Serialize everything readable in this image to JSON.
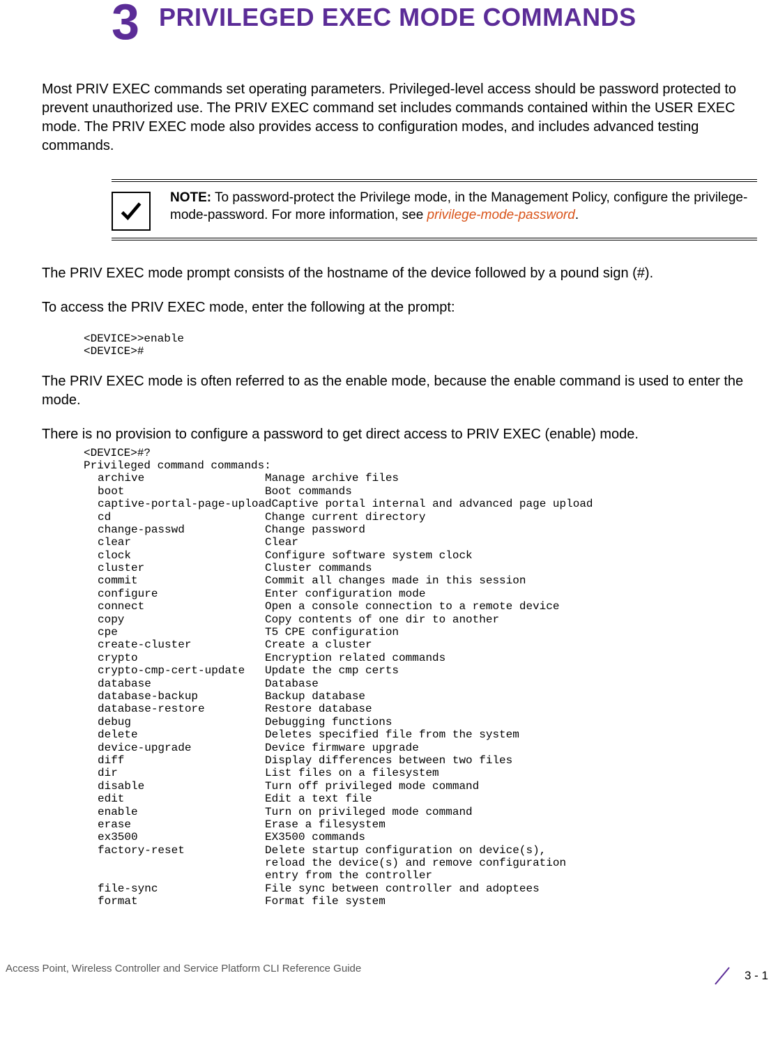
{
  "chapter": {
    "number": "3",
    "title": "PRIVILEGED EXEC MODE COMMANDS"
  },
  "intro": "Most PRIV EXEC commands set operating parameters. Privileged-level access should be password protected to prevent unauthorized use. The PRIV EXEC command set includes commands contained within the USER EXEC mode. The PRIV EXEC mode also provides access to configuration modes, and includes advanced testing commands.",
  "note": {
    "label": "NOTE:",
    "body": " To password-protect the Privilege mode, in the Management Policy, configure the privilege-mode-password. For more information, see ",
    "link": "privilege-mode-password"
  },
  "p1": "The PRIV EXEC mode prompt consists of the hostname of the device followed by a pound sign (#).",
  "p2": "To access the PRIV EXEC mode, enter the following at the prompt:",
  "cli1": "<DEVICE>>enable\n<DEVICE>#",
  "p3": "The PRIV EXEC mode is often referred to as the enable mode, because the enable command is used to enter the mode.",
  "p4": "There is no provision to configure a password to get direct access to PRIV EXEC (enable) mode.",
  "cli2_head1": "<DEVICE>#?",
  "cli2_head2": "Privileged command commands:",
  "commands": [
    {
      "name": "archive",
      "desc": "Manage archive files"
    },
    {
      "name": "boot",
      "desc": "Boot commands"
    },
    {
      "name": "captive-portal-page-upload",
      "desc": "Captive portal internal and advanced page upload"
    },
    {
      "name": "cd",
      "desc": "Change current directory"
    },
    {
      "name": "change-passwd",
      "desc": "Change password"
    },
    {
      "name": "clear",
      "desc": "Clear"
    },
    {
      "name": "clock",
      "desc": "Configure software system clock"
    },
    {
      "name": "cluster",
      "desc": "Cluster commands"
    },
    {
      "name": "commit",
      "desc": "Commit all changes made in this session"
    },
    {
      "name": "configure",
      "desc": "Enter configuration mode"
    },
    {
      "name": "connect",
      "desc": "Open a console connection to a remote device"
    },
    {
      "name": "copy",
      "desc": "Copy contents of one dir to another"
    },
    {
      "name": "cpe",
      "desc": "T5 CPE configuration"
    },
    {
      "name": "create-cluster",
      "desc": "Create a cluster"
    },
    {
      "name": "crypto",
      "desc": "Encryption related commands"
    },
    {
      "name": "crypto-cmp-cert-update",
      "desc": "Update the cmp certs"
    },
    {
      "name": "database",
      "desc": "Database"
    },
    {
      "name": "database-backup",
      "desc": "Backup database"
    },
    {
      "name": "database-restore",
      "desc": "Restore database"
    },
    {
      "name": "debug",
      "desc": "Debugging functions"
    },
    {
      "name": "delete",
      "desc": "Deletes specified file from the system"
    },
    {
      "name": "device-upgrade",
      "desc": "Device firmware upgrade"
    },
    {
      "name": "diff",
      "desc": "Display differences between two files"
    },
    {
      "name": "dir",
      "desc": "List files on a filesystem"
    },
    {
      "name": "disable",
      "desc": "Turn off privileged mode command"
    },
    {
      "name": "edit",
      "desc": "Edit a text file"
    },
    {
      "name": "enable",
      "desc": "Turn on privileged mode command"
    },
    {
      "name": "erase",
      "desc": "Erase a filesystem"
    },
    {
      "name": "ex3500",
      "desc": "EX3500 commands"
    },
    {
      "name": "factory-reset",
      "desc": "Delete startup configuration on device(s),\nreload the device(s) and remove configuration\nentry from the controller"
    },
    {
      "name": "file-sync",
      "desc": "File sync between controller and adoptees"
    },
    {
      "name": "format",
      "desc": "Format file system"
    }
  ],
  "footer": {
    "guide": "Access Point, Wireless Controller and Service Platform CLI Reference Guide",
    "page": "3 - 1"
  }
}
